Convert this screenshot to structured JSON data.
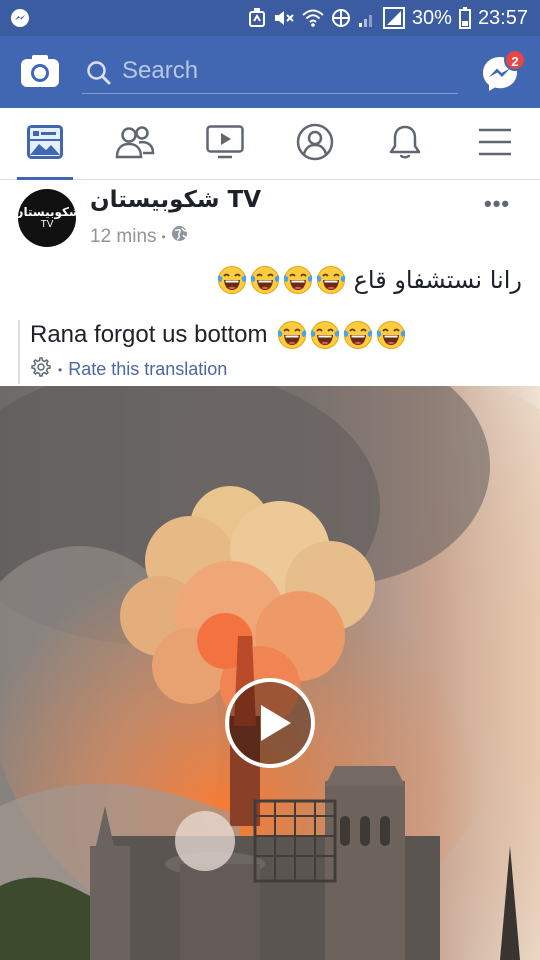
{
  "status_bar": {
    "battery_percent": "30%",
    "time": "23:57",
    "icons": [
      "messenger-notification-icon",
      "nfc-icon",
      "mute-icon",
      "wifi-icon",
      "data-saver-icon",
      "signal-icon",
      "signal-icon",
      "battery-icon"
    ]
  },
  "header": {
    "search_placeholder": "Search",
    "messenger_badge": "2",
    "icons": [
      "camera-icon",
      "search-icon",
      "messenger-icon"
    ]
  },
  "nav": {
    "tabs": [
      {
        "name": "news-feed",
        "icon": "news-feed-icon",
        "active": true
      },
      {
        "name": "friends",
        "icon": "friends-icon",
        "active": false
      },
      {
        "name": "watch",
        "icon": "watch-icon",
        "active": false
      },
      {
        "name": "profile",
        "icon": "profile-icon",
        "active": false
      },
      {
        "name": "notifications",
        "icon": "bell-icon",
        "active": false
      },
      {
        "name": "menu",
        "icon": "hamburger-icon",
        "active": false
      }
    ],
    "active_color": "#4267b2"
  },
  "post": {
    "avatar": {
      "line1": "شكوبيستان",
      "line2": "TV"
    },
    "page_name": "شكوبيستان TV",
    "time": "12 mins",
    "separator": "•",
    "audience_icon": "globe-icon",
    "more": "•••",
    "text": "رانا نستشفاو قاع",
    "text_emoji_count": 4,
    "translation": {
      "text": "Rana forgot us bottom",
      "emoji_count": 4,
      "rate_separator": "•",
      "rate_link": "Rate this translation"
    }
  },
  "video": {
    "content": "video of a burning cathedral with smoke",
    "control_icon": "play-icon"
  },
  "colors": {
    "brand": "#4267b2",
    "statusbar": "#3b5ca0",
    "link": "#4b67a1",
    "meta": "#90949c"
  }
}
